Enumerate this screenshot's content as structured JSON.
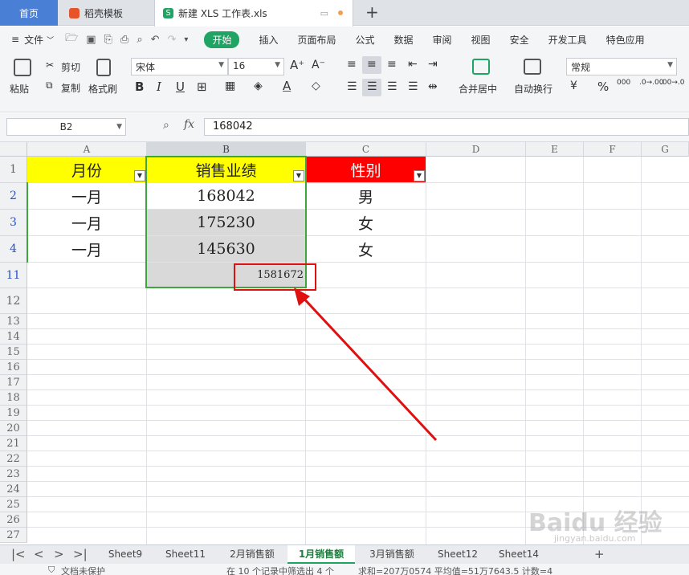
{
  "tabs": {
    "home": "首页",
    "doc": "稻壳模板",
    "file": "新建 XLS 工作表.xls",
    "file_icon": "S",
    "add": "+"
  },
  "menu": {
    "file": "文件",
    "items": [
      "开始",
      "插入",
      "页面布局",
      "公式",
      "数据",
      "审阅",
      "视图",
      "安全",
      "开发工具",
      "特色应用"
    ]
  },
  "ribbon": {
    "paste": "粘贴",
    "cut": "剪切",
    "copy": "复制",
    "format_painter": "格式刷",
    "font_name": "宋体",
    "font_size": "16",
    "bold": "B",
    "italic": "I",
    "underline": "U",
    "merge": "合并居中",
    "wrap": "自动换行",
    "number_format": "常规",
    "percent": "%"
  },
  "formula_bar": {
    "name_box": "B2",
    "fx": "fx",
    "value": "168042"
  },
  "grid": {
    "columns": [
      "A",
      "B",
      "C",
      "D",
      "E",
      "F",
      "G"
    ],
    "rows": [
      "1",
      "2",
      "3",
      "4",
      "11",
      "12",
      "13",
      "14",
      "15",
      "16",
      "17",
      "18",
      "19",
      "20",
      "21",
      "22",
      "23",
      "24",
      "25",
      "26",
      "27"
    ],
    "header": [
      "月份",
      "销售业绩",
      "性别"
    ],
    "data": [
      [
        "一月",
        "168042",
        "男"
      ],
      [
        "一月",
        "175230",
        "女"
      ],
      [
        "一月",
        "145630",
        "女"
      ]
    ],
    "sum_value": "1581672"
  },
  "sheets": {
    "list": [
      "Sheet9",
      "Sheet11",
      "2月销售额",
      "1月销售额",
      "3月销售额",
      "Sheet12",
      "Sheet14"
    ],
    "active": "1月销售额"
  },
  "status": {
    "protect": "文档未保护",
    "filter": "在 10 个记录中筛选出 4 个",
    "stats": "求和=207万0574  平均值=51万7643.5  计数=4"
  },
  "watermark": {
    "logo": "Baidu 经验",
    "url": "jingyan.baidu.com"
  },
  "colors": {
    "accent_green": "#1fa463",
    "header_yellow": "#ffff00",
    "header_red": "#ff0000",
    "annotation_red": "#e01010"
  }
}
